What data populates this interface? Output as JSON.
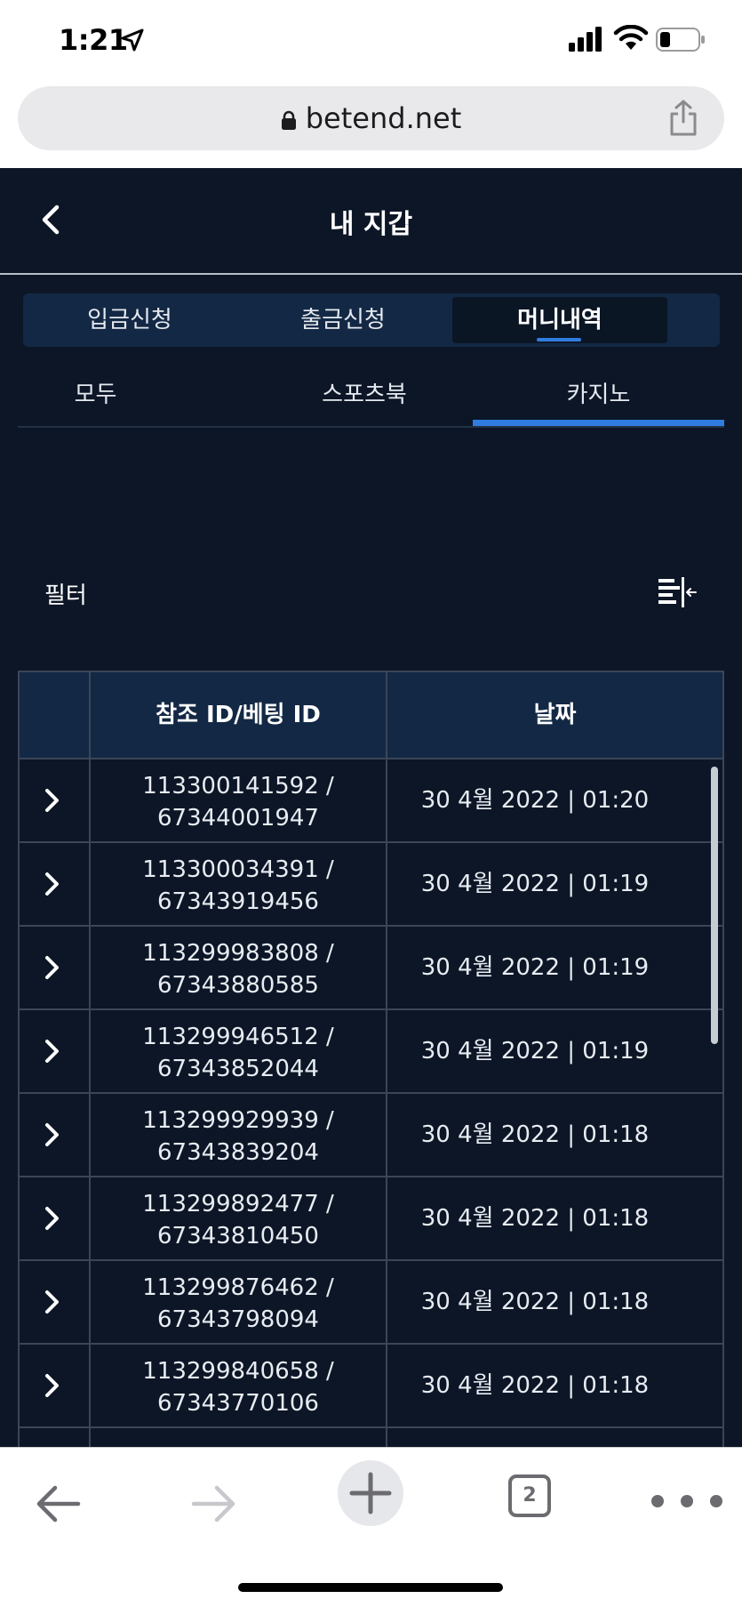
{
  "status_bar": {
    "time": "1:21"
  },
  "browser": {
    "url": "betend.net",
    "open_tabs": "2"
  },
  "header": {
    "title": "내 지갑"
  },
  "main_tabs": [
    {
      "label": "입금신청"
    },
    {
      "label": "출금신청"
    },
    {
      "label": "머니내역"
    }
  ],
  "sub_tabs": [
    {
      "label": "모두"
    },
    {
      "label": "스포츠북"
    },
    {
      "label": "카지노"
    }
  ],
  "filter": {
    "label": "필터"
  },
  "table": {
    "headers": {
      "ref": "참조 ID/베팅 ID",
      "date": "날짜"
    },
    "rows": [
      {
        "ref_line1": "113300141592 /",
        "ref_line2": "67344001947",
        "date": "30 4월 2022 | 01:20"
      },
      {
        "ref_line1": "113300034391 /",
        "ref_line2": "67343919456",
        "date": "30 4월 2022 | 01:19"
      },
      {
        "ref_line1": "113299983808 /",
        "ref_line2": "67343880585",
        "date": "30 4월 2022 | 01:19"
      },
      {
        "ref_line1": "113299946512 /",
        "ref_line2": "67343852044",
        "date": "30 4월 2022 | 01:19"
      },
      {
        "ref_line1": "113299929939 /",
        "ref_line2": "67343839204",
        "date": "30 4월 2022 | 01:18"
      },
      {
        "ref_line1": "113299892477 /",
        "ref_line2": "67343810450",
        "date": "30 4월 2022 | 01:18"
      },
      {
        "ref_line1": "113299876462 /",
        "ref_line2": "67343798094",
        "date": "30 4월 2022 | 01:18"
      },
      {
        "ref_line1": "113299840658 /",
        "ref_line2": "67343770106",
        "date": "30 4월 2022 | 01:18"
      }
    ]
  },
  "colors": {
    "background": "#0c1626",
    "accent": "#2f7de0",
    "panel": "#132844"
  },
  "icons": [
    "location-arrow-icon",
    "signal-icon",
    "wifi-icon",
    "battery-icon",
    "lock-icon",
    "share-icon",
    "back-icon",
    "filter-icon",
    "chevron-right-icon",
    "nav-back-icon",
    "nav-forward-icon",
    "plus-icon",
    "more-icon"
  ]
}
